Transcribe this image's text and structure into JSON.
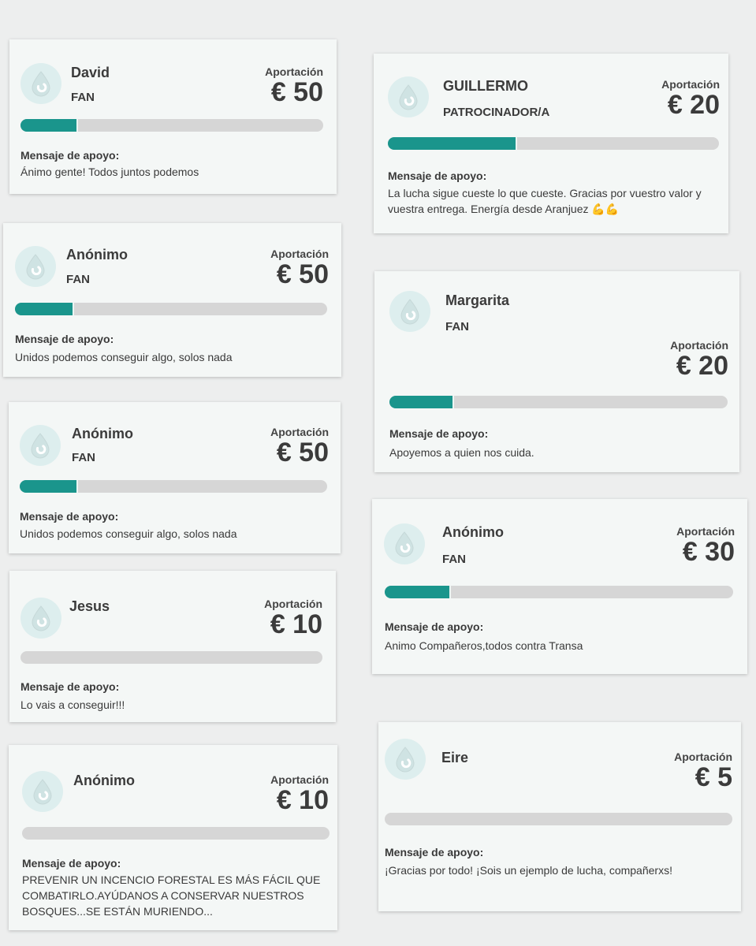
{
  "labels": {
    "contribution": "Aportación",
    "message": "Mensaje de apoyo:"
  },
  "colors": {
    "progress_fill": "#1a958c",
    "progress_track": "#d6d6d6",
    "card_background": "#f4f7f6",
    "avatar_background": "#ddeeee"
  },
  "icons": {
    "avatar": "drop-icon"
  },
  "supporters": [
    {
      "name": "David",
      "role": "FAN",
      "amount": "€ 50",
      "progress": 0.19,
      "message": "Ánimo gente! Todos juntos podemos"
    },
    {
      "name": "Anónimo",
      "role": "FAN",
      "amount": "€ 50",
      "progress": 0.19,
      "message": "Unidos podemos conseguir algo, solos nada"
    },
    {
      "name": "Anónimo",
      "role": "FAN",
      "amount": "€ 50",
      "progress": 0.19,
      "message": "Unidos podemos conseguir algo, solos nada"
    },
    {
      "name": "Jesus",
      "role": "",
      "amount": "€ 10",
      "progress": 0,
      "message": "Lo vais a conseguir!!!"
    },
    {
      "name": "Anónimo",
      "role": "",
      "amount": "€ 10",
      "progress": 0,
      "message": "PREVENIR UN INCENCIO FORESTAL ES MÁS FÁCIL QUE COMBATIRLO.AYÚDANOS A CONSERVAR NUESTROS BOSQUES...SE ESTÁN MURIENDO..."
    },
    {
      "name": "GUILLERMO",
      "role": "PATROCINADOR/A",
      "amount": "€ 20",
      "progress": 0.39,
      "message": "La lucha sigue cueste lo que cueste. Gracias por vuestro valor y vuestra entrega. Energía desde Aranjuez 💪💪"
    },
    {
      "name": "Margarita",
      "role": "FAN",
      "amount": "€ 20",
      "progress": 0.19,
      "message": "Apoyemos a quien nos cuida."
    },
    {
      "name": "Anónimo",
      "role": "FAN",
      "amount": "€ 30",
      "progress": 0.19,
      "message": "Animo Compañeros,todos contra Transa"
    },
    {
      "name": "Eire",
      "role": "",
      "amount": "€ 5",
      "progress": 0,
      "message": "¡Gracias por todo! ¡Sois un ejemplo de lucha, compañerxs!"
    }
  ]
}
